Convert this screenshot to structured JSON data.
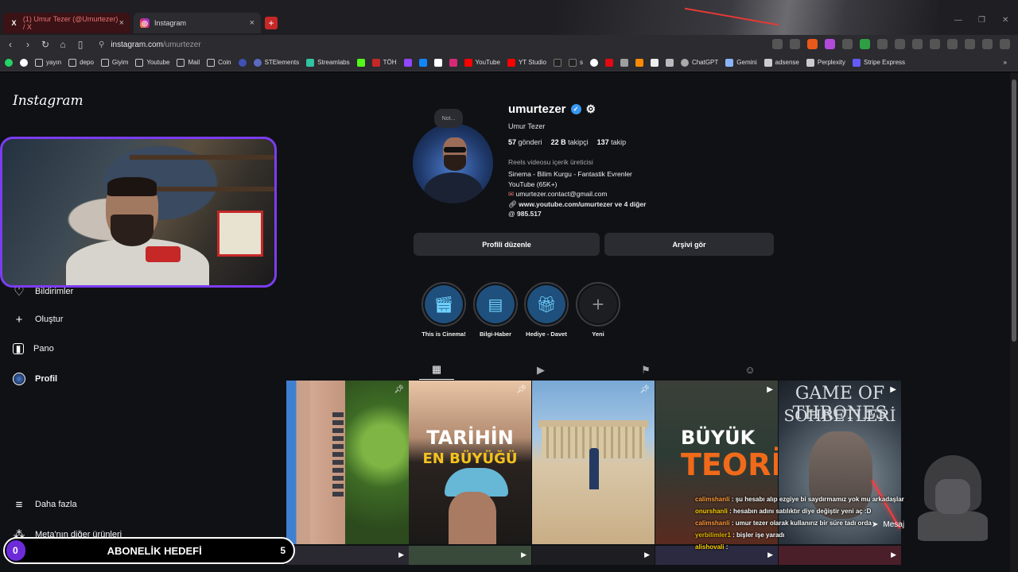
{
  "browser": {
    "tabs": [
      {
        "title": "(1) Umur Tezer (@Umurtezer) / X",
        "icon": "x-icon"
      },
      {
        "title": "Instagram",
        "icon": "instagram-icon"
      }
    ],
    "url_domain": "instagram.com",
    "url_path": "/umurtezer",
    "bookmarks": [
      "yayın",
      "depo",
      "Giyim",
      "Youtube",
      "Mail",
      "Coin",
      "STElements",
      "Streamlabs",
      "TÖH",
      "YouTube",
      "YT Studio",
      "s",
      "ChatGPT",
      "Gemini",
      "adsense",
      "Perplexity",
      "Stripe Express"
    ]
  },
  "sidebar": {
    "logo": "Instagram",
    "items": {
      "notifications": "Bildirimler",
      "create": "Oluştur",
      "dashboard": "Pano",
      "profile": "Profil",
      "more": "Daha fazla",
      "meta": "Meta'nın diğer ürünleri"
    }
  },
  "profile": {
    "note": "Not...",
    "username": "umurtezer",
    "full_name": "Umur Tezer",
    "posts_count": "57",
    "posts_label": "gönderi",
    "followers_count": "22 B",
    "followers_label": "takipçi",
    "following_count": "137",
    "following_label": "takip",
    "category": "Reels videosu içerik üreticisi",
    "bio_line1": "Sinema - Bilim Kurgu - Fantastik Evrenler",
    "bio_line2": "YouTube (65K+)",
    "email": "umurtezer.contact@gmail.com",
    "link": "www.youtube.com/umurtezer ve 4 diğer",
    "threads": "985.517",
    "edit_button": "Profili düzenle",
    "archive_button": "Arşivi gör"
  },
  "highlights": [
    {
      "label": "This is Cinema!",
      "icon": "clapperboard-icon"
    },
    {
      "label": "Bilgi-Haber",
      "icon": "document-icon"
    },
    {
      "label": "Hediye - Davet",
      "icon": "gift-icon"
    },
    {
      "label": "Yeni",
      "icon": "plus-icon"
    }
  ],
  "posts": [
    {
      "kind": "pinned",
      "title1": "",
      "title2": ""
    },
    {
      "kind": "pinned",
      "title1": "TARİHİN",
      "title2": "EN BÜYÜĞÜ"
    },
    {
      "kind": "pinned",
      "title1": "",
      "title2": ""
    },
    {
      "kind": "reel",
      "title1": "BÜYÜK",
      "title2": "TEORİ"
    },
    {
      "kind": "reel",
      "title1": "GAME OF THRONES",
      "title2": "SOHBETLERİ"
    }
  ],
  "chat": [
    {
      "user": "calimshanli",
      "text": ": şu hesabı alıp ezgiye bi saydırmamız yok mu arkadaşlar"
    },
    {
      "user": "onurshanli",
      "text": ": hesabın adını satılıktır diye değiştir yeni aç :D"
    },
    {
      "user": "calimshanli",
      "text": ": umur tezer olarak kullanırız bir süre tadı orda"
    },
    {
      "user": "yerbilimler1",
      "text": ": bişler işe yaradı"
    },
    {
      "user": "alishovali",
      "text": ":"
    }
  ],
  "messages_label": "Mesaj",
  "goal": {
    "current": "0",
    "title": "ABONELİK HEDEFİ",
    "target": "5"
  }
}
